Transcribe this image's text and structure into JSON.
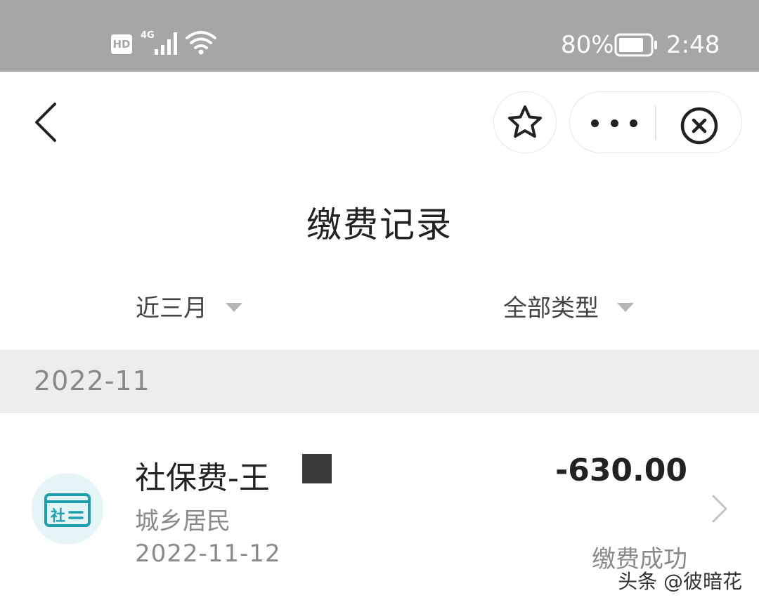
{
  "status_bar": {
    "hd": "HD",
    "network": "4G",
    "battery_percent": "80%",
    "time": "2:48"
  },
  "nav": {
    "back_icon": "chevron-left-icon",
    "favorite_icon": "star-icon",
    "more_icon": "more-dots-icon",
    "close_icon": "close-circle-icon"
  },
  "page": {
    "title": "缴费记录"
  },
  "filters": {
    "range": "近三月",
    "type": "全部类型"
  },
  "records": {
    "month": "2022-11",
    "items": [
      {
        "icon_text": "社",
        "title": "社保费-王",
        "category": "城乡居民",
        "date": "2022-11-12",
        "amount": "-630.00",
        "status": "缴费成功"
      }
    ]
  },
  "watermark": "头条 @彼暗花",
  "colors": {
    "status_bar": "#a6a6a6",
    "section_bg": "#ededed",
    "icon_bg": "#e5f4f6",
    "icon_accent": "#1f9fae"
  }
}
